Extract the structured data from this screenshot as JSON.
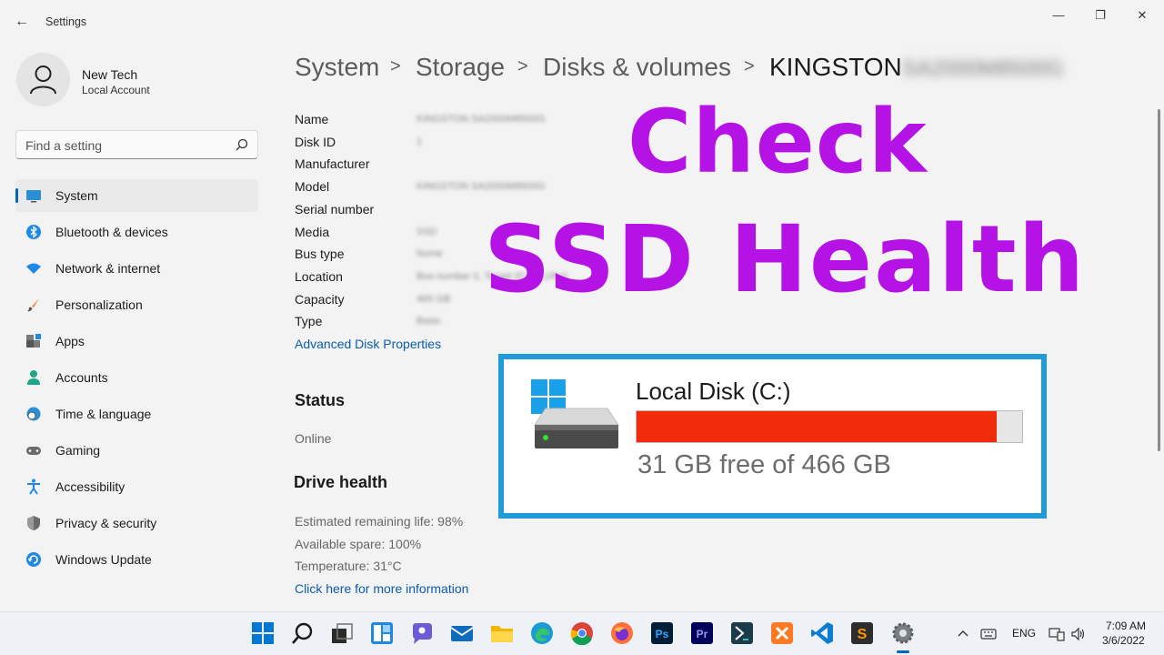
{
  "window": {
    "app_title": "Settings",
    "back_glyph": "←",
    "minimize_glyph": "—",
    "maximize_glyph": "❐",
    "close_glyph": "✕"
  },
  "profile": {
    "name": "New Tech",
    "account_type": "Local Account"
  },
  "search": {
    "placeholder": "Find a setting"
  },
  "sidebar": {
    "items": [
      {
        "label": "System",
        "icon": "monitor-icon",
        "active": true
      },
      {
        "label": "Bluetooth & devices",
        "icon": "bluetooth-icon"
      },
      {
        "label": "Network & internet",
        "icon": "wifi-icon"
      },
      {
        "label": "Personalization",
        "icon": "brush-icon"
      },
      {
        "label": "Apps",
        "icon": "apps-icon"
      },
      {
        "label": "Accounts",
        "icon": "person-icon"
      },
      {
        "label": "Time & language",
        "icon": "globe-clock-icon"
      },
      {
        "label": "Gaming",
        "icon": "gamepad-icon"
      },
      {
        "label": "Accessibility",
        "icon": "accessibility-icon"
      },
      {
        "label": "Privacy & security",
        "icon": "shield-icon"
      },
      {
        "label": "Windows Update",
        "icon": "update-icon"
      }
    ]
  },
  "breadcrumb": {
    "items": [
      "System",
      "Storage",
      "Disks & volumes"
    ],
    "separator": ">",
    "current": "KINGSTON",
    "current_blurred": "SA2000M8500G"
  },
  "properties": {
    "rows": [
      {
        "label": "Name",
        "value": "KINGSTON SA2000M8500G"
      },
      {
        "label": "Disk ID",
        "value": "1"
      },
      {
        "label": "Manufacturer",
        "value": ""
      },
      {
        "label": "Model",
        "value": "KINGSTON SA2000M8500G"
      },
      {
        "label": "Serial number",
        "value": ""
      },
      {
        "label": "Media",
        "value": "SSD"
      },
      {
        "label": "Bus type",
        "value": "Nvme"
      },
      {
        "label": "Location",
        "value": "Bus number 0, Target ID 0, LUN 0"
      },
      {
        "label": "Capacity",
        "value": "465 GB"
      },
      {
        "label": "Type",
        "value": "Basic"
      }
    ],
    "advanced_link": "Advanced Disk Properties"
  },
  "status": {
    "title": "Status",
    "value": "Online"
  },
  "drive_health": {
    "title": "Drive health",
    "remaining_life": "Estimated remaining life: 98%",
    "available_spare": "Available spare: 100%",
    "temperature": "Temperature: 31°C",
    "more_info_link": "Click here for more information"
  },
  "overlay": {
    "line1": "Check",
    "line2": "SSD Health",
    "color": "#b512e6"
  },
  "disk_card": {
    "title": "Local Disk (C:)",
    "free_text": "31 GB free of 466 GB",
    "used_fraction": 0.933,
    "bar_color": "#f22b0b",
    "border_color": "#1f9bd8"
  },
  "taskbar": {
    "apps": [
      "start-icon",
      "search-icon",
      "task-view-icon",
      "widgets-icon",
      "chat-icon",
      "mail-icon",
      "file-explorer-icon",
      "edge-icon",
      "chrome-icon",
      "firefox-icon",
      "photoshop-icon",
      "premiere-icon",
      "app-icon",
      "xampp-icon",
      "vscode-icon",
      "sublime-icon",
      "settings-icon"
    ],
    "photoshop_label": "Ps",
    "premiere_label": "Pr",
    "sublime_label": "S",
    "language": "ENG",
    "time": "7:09 AM",
    "date": "3/6/2022"
  }
}
